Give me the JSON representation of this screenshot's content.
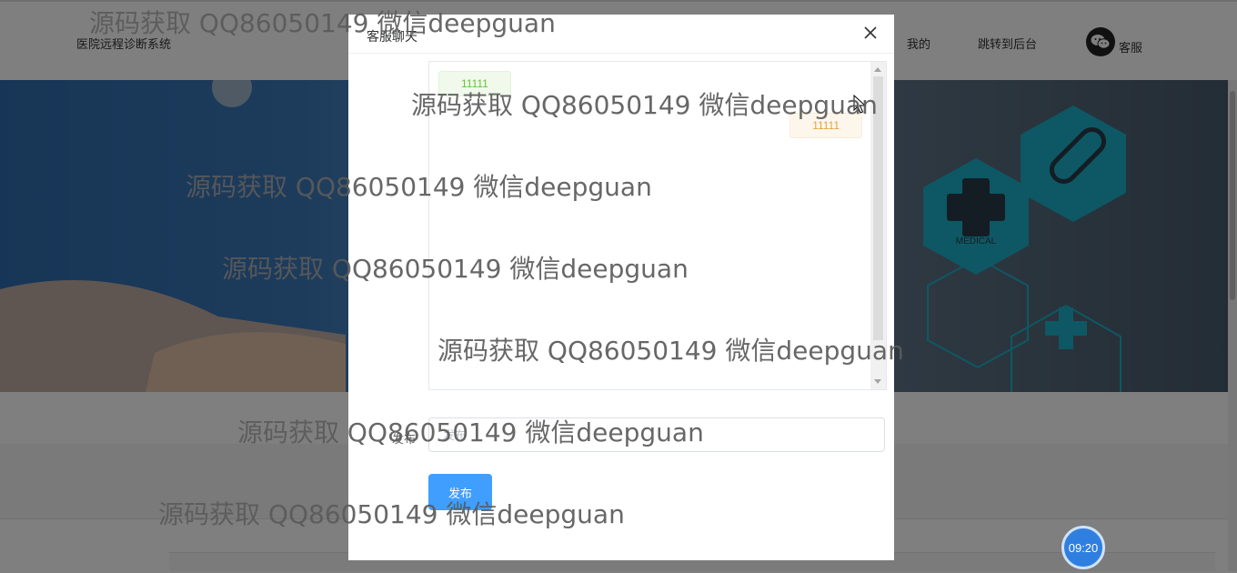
{
  "header": {
    "system_title": "医院远程诊断系统",
    "nav": {
      "mine": "我的",
      "backend": "跳转到后台"
    },
    "kefu_label": "客服"
  },
  "dialog": {
    "title": "客服聊天",
    "messages": [
      {
        "side": "left",
        "text": "11111"
      },
      {
        "side": "right",
        "text": "11111"
      }
    ],
    "form_label": "发布",
    "input_value": "",
    "input_placeholder": "发布",
    "submit_label": "发布"
  },
  "clock": {
    "time": "09:20"
  },
  "watermark": {
    "text1": "源码获取 QQ86050149 微信deepguan",
    "text2": "源码获取 QQ86050149 微信deepguan",
    "text3": "源码获取 QQ86050149 微信deepguan",
    "text4": "源码获取 QQ86050149 微信deepguan",
    "text5": "源码获取 QQ86050149 微信deepguan",
    "text6": "源码获取 QQ86050149 微信deepguan",
    "text7": "源码获取 QQ86050149 微信deepguan"
  },
  "colors": {
    "primary": "#409eff",
    "success_bg": "#f0f9eb",
    "warning_bg": "#fdf6ec",
    "overlay": "rgba(0,0,0,0.5)"
  },
  "icons": {
    "close": "close-icon",
    "wechat": "wechat-icon"
  }
}
